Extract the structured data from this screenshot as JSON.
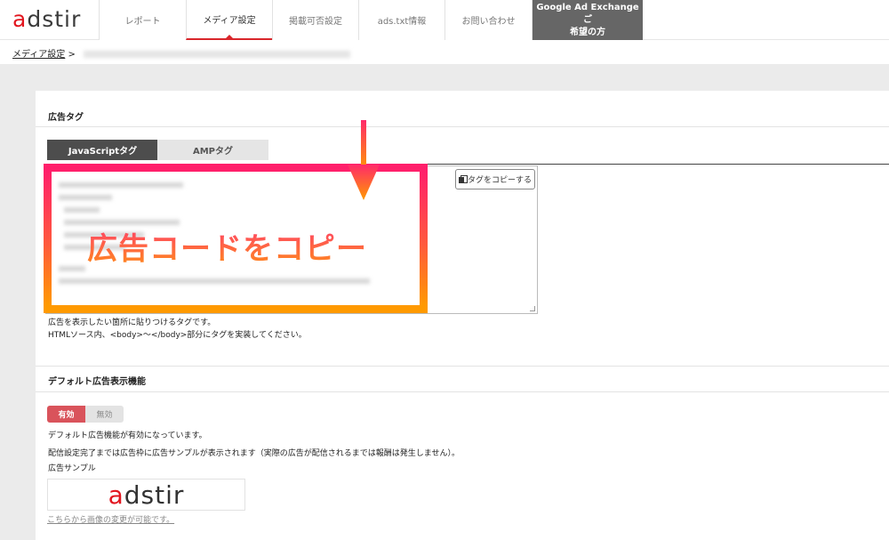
{
  "nav": {
    "logo_prefix": "a",
    "logo_rest": "dstir",
    "tabs": [
      {
        "label": "レポート"
      },
      {
        "label": "メディア設定"
      },
      {
        "label": "掲載可否設定"
      },
      {
        "label": "ads.txt情報"
      },
      {
        "label": "お問い合わせ"
      },
      {
        "label_line1": "Google Ad Exchangeご",
        "label_line2": "希望の方"
      }
    ]
  },
  "breadcrumb": {
    "link": "メディア設定",
    "separator": ">"
  },
  "ad_tag": {
    "title": "広告タグ",
    "tabs": [
      {
        "label": "JavaScriptタグ"
      },
      {
        "label": "AMPタグ"
      }
    ],
    "copy_button": "タグをコピーする",
    "annotation": "広告コードをコピー",
    "help_line1": "広告を表示したい箇所に貼りつけるタグです。",
    "help_line2": "HTMLソース内、<body>～</body>部分にタグを実装してください。"
  },
  "default_ad": {
    "title": "デフォルト広告表示機能",
    "toggle_on": "有効",
    "toggle_off": "無効",
    "status_text": "デフォルト広告機能が有効になっています。",
    "info_text": "配信設定完了までは広告枠に広告サンプルが表示されます（実際の広告が配信されるまでは報酬は発生しません）。",
    "sample_label": "広告サンプル",
    "sample_logo_prefix": "a",
    "sample_logo_rest": "dstir",
    "change_link": "こちらから画像の変更が可能です。"
  },
  "colors": {
    "brand_red": "#e2161f",
    "active_tab": "#d9262b",
    "toggle_on": "#d9535b",
    "highlight_start": "#ff1f6b",
    "highlight_end": "#ff9a00"
  }
}
